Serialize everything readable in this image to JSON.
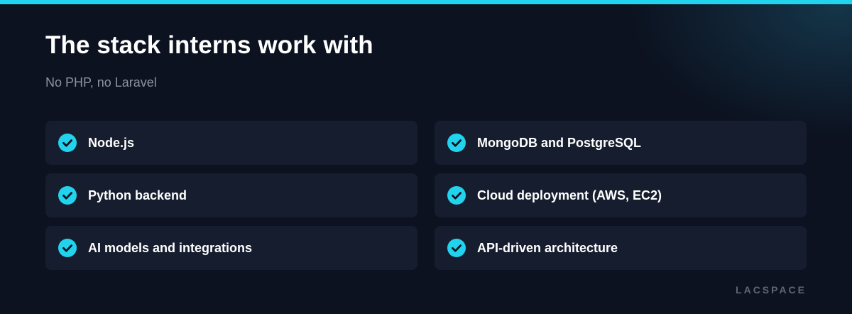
{
  "header": {
    "title": "The stack interns work with",
    "subtitle": "No PHP, no Laravel"
  },
  "stack": {
    "items": [
      {
        "label": "Node.js",
        "icon": "check-circle-icon"
      },
      {
        "label": "MongoDB and PostgreSQL",
        "icon": "check-circle-icon"
      },
      {
        "label": "Python backend",
        "icon": "check-circle-icon"
      },
      {
        "label": "Cloud deployment (AWS, EC2)",
        "icon": "check-circle-icon"
      },
      {
        "label": "AI models and integrations",
        "icon": "check-circle-icon"
      },
      {
        "label": "API-driven architecture",
        "icon": "check-circle-icon"
      }
    ]
  },
  "footer": {
    "brand": "LACSPACE"
  },
  "colors": {
    "accent": "#22d3ee",
    "background": "#0c1220",
    "card": "#161d2e",
    "muted_text": "#8b93a3"
  }
}
